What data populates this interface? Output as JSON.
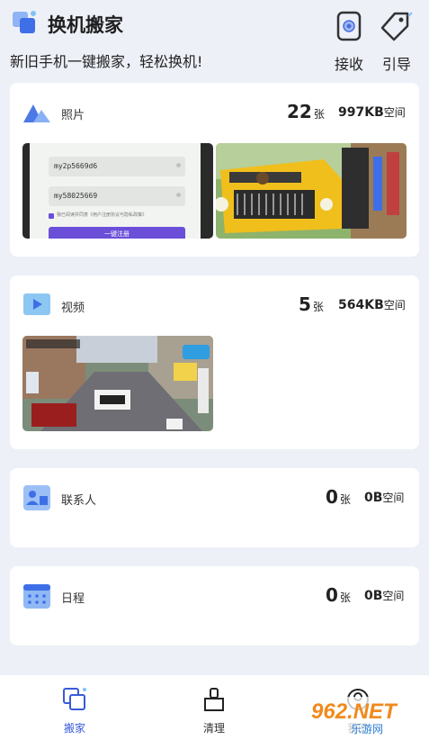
{
  "header": {
    "title": "换机搬家",
    "subtitle": "新旧手机一键搬家，轻松换机!",
    "receive_label": "接收",
    "guide_label": "引导"
  },
  "cards": {
    "photos": {
      "title": "照片",
      "count": "22",
      "count_unit": "张",
      "size": "997KB",
      "size_unit": "空间"
    },
    "videos": {
      "title": "视频",
      "count": "5",
      "count_unit": "张",
      "size": "564KB",
      "size_unit": "空间"
    },
    "contacts": {
      "title": "联系人",
      "count": "0",
      "count_unit": "张",
      "size": "0B",
      "size_unit": "空间"
    },
    "schedule": {
      "title": "日程",
      "count": "0",
      "count_unit": "张",
      "size": "0B",
      "size_unit": "空间"
    }
  },
  "photo_thumb_1": {
    "field1": "my2p5669d6",
    "field2": "my58025669",
    "agree_text": "我已阅读并同意《用户注册协议与隐私政策》",
    "button_text": "一键注册"
  },
  "tabs": {
    "move": "搬家",
    "clean": "清理",
    "mine": "我的"
  },
  "watermark": {
    "brand": "962.NET",
    "sub": "乐游网"
  },
  "colors": {
    "accent": "#3a5bd9",
    "page_bg": "#eef0f8",
    "icon_blue": "#5a8df0"
  }
}
